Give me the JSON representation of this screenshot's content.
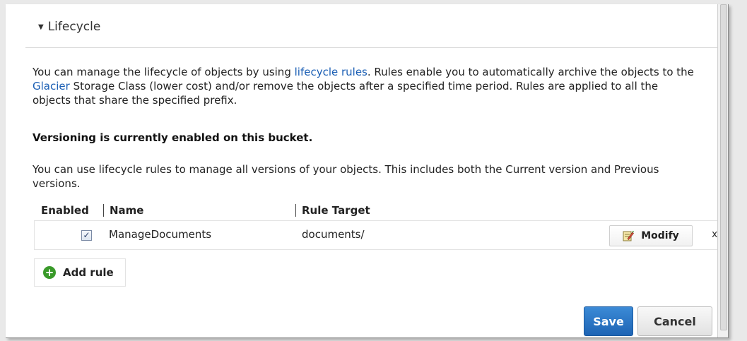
{
  "section": {
    "title": "Lifecycle",
    "toggle_icon": "triangle-down-icon"
  },
  "intro": {
    "before_link1": "You can manage the lifecycle of objects by using ",
    "link1": "lifecycle rules",
    "after_link1": ". Rules enable you to automatically archive the objects to the ",
    "link2": "Glacier",
    "after_link2": " Storage Class (lower cost) and/or remove the objects after a specified time period. Rules are applied to all the objects that share the specified prefix."
  },
  "versioning_notice": "Versioning is currently enabled on this bucket.",
  "versioning_text": "You can use lifecycle rules to manage all versions of your objects. This includes both the Current version and Previous versions.",
  "table": {
    "headers": {
      "enabled": "Enabled",
      "name": "Name",
      "target": "Rule Target"
    },
    "rows": [
      {
        "enabled": true,
        "name": "ManageDocuments",
        "target": "documents/",
        "modify_label": "Modify",
        "delete_label": "x"
      }
    ]
  },
  "add_rule_label": "Add rule",
  "footer": {
    "save_label": "Save",
    "cancel_label": "Cancel"
  },
  "colors": {
    "link": "#1a5eb4",
    "primary_button": "#1e64b4",
    "add_icon": "#3a9a2a"
  },
  "icons": {
    "checkbox": "checkbox-checked-icon",
    "modify": "edit-note-icon",
    "add": "plus-circle-icon"
  }
}
